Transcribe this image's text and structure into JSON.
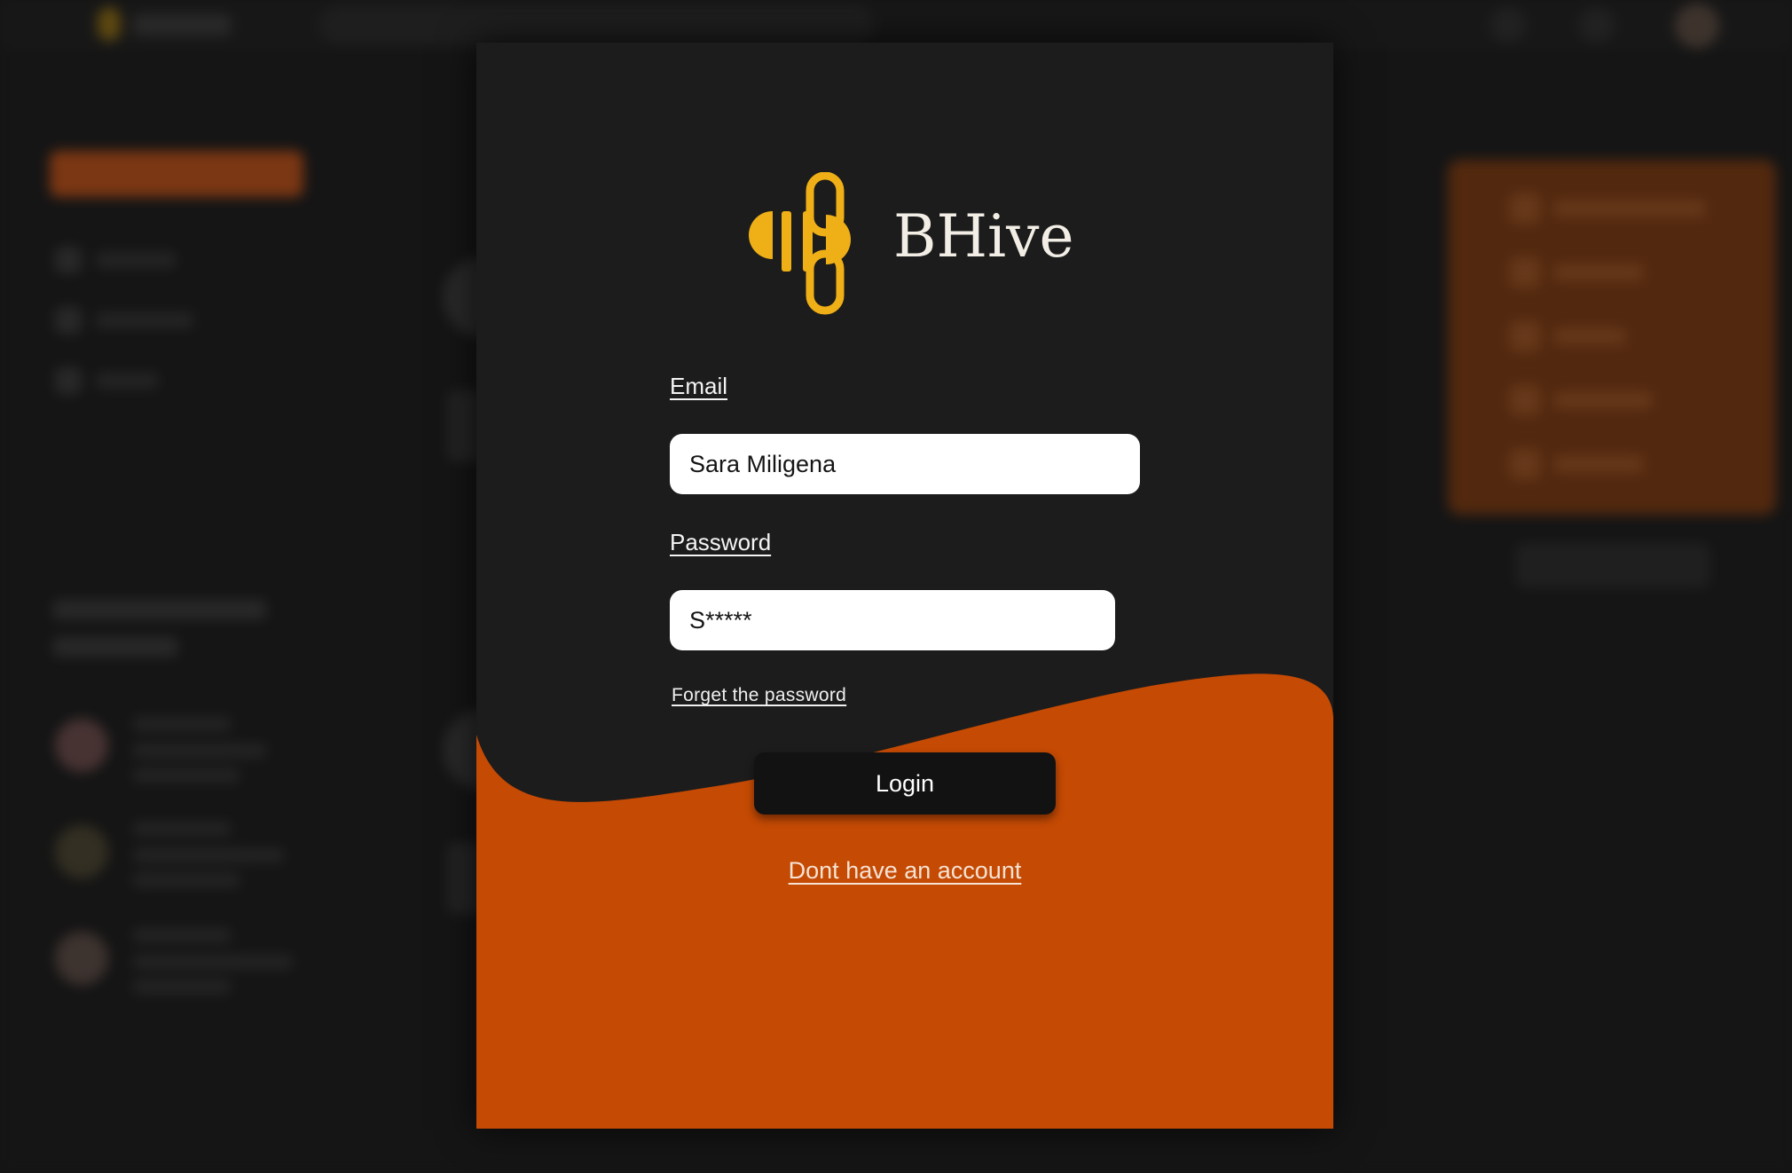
{
  "app": {
    "brand_name": "BHive"
  },
  "login_form": {
    "email_label": "Email",
    "email_value": "Sara Miligena",
    "password_label": "Password",
    "password_value": "S*****",
    "forgot_password_label": "Forget the password",
    "login_button_label": "Login",
    "signup_link_label": "Dont have an account"
  },
  "colors": {
    "modal_background": "#1c1c1c",
    "accent_orange": "#c54a04",
    "logo_yellow": "#efaf16",
    "button_background": "#121212",
    "input_background": "#ffffff"
  },
  "icons": {
    "logo": "bee-logo-icon"
  }
}
